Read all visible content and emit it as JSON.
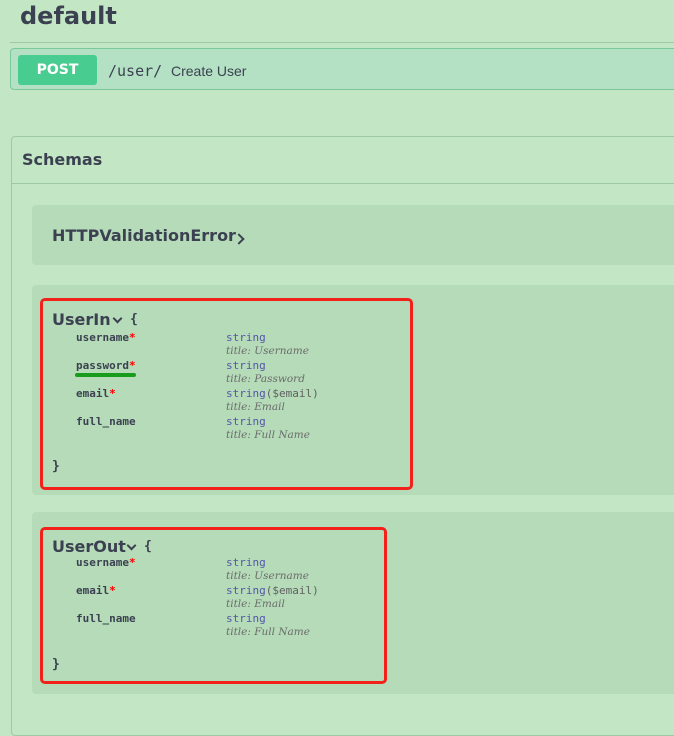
{
  "section": {
    "title": "default"
  },
  "operation": {
    "method": "POST",
    "path": "/user/",
    "summary": "Create User"
  },
  "schemas": {
    "title": "Schemas",
    "models": [
      {
        "name": "HTTPValidationError"
      },
      {
        "name": "UserIn",
        "open_brace": "{",
        "close_brace": "}",
        "properties": [
          {
            "name": "username",
            "required": true,
            "type": "string",
            "format": "",
            "title": "title: Username"
          },
          {
            "name": "password",
            "required": true,
            "type": "string",
            "format": "",
            "title": "title: Password"
          },
          {
            "name": "email",
            "required": true,
            "type": "string",
            "format": "($email)",
            "title": "title: Email"
          },
          {
            "name": "full_name",
            "required": false,
            "type": "string",
            "format": "",
            "title": "title: Full Name"
          }
        ]
      },
      {
        "name": "UserOut",
        "open_brace": "{",
        "close_brace": "}",
        "properties": [
          {
            "name": "username",
            "required": true,
            "type": "string",
            "format": "",
            "title": "title: Username"
          },
          {
            "name": "email",
            "required": true,
            "type": "string",
            "format": "($email)",
            "title": "title: Email"
          },
          {
            "name": "full_name",
            "required": false,
            "type": "string",
            "format": "",
            "title": "title: Full Name"
          }
        ]
      }
    ]
  },
  "required_marker": "*",
  "colors": {
    "page_bg": "#c3e6c4",
    "post_badge": "#49cc90",
    "highlight_box": "#f2211a",
    "underline_mark": "#179c1c"
  }
}
